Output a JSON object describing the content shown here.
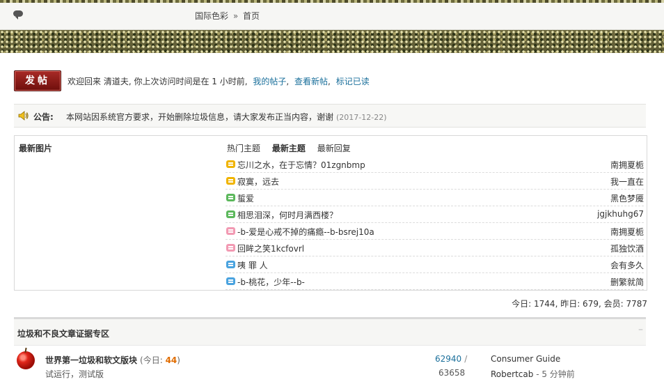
{
  "breadcrumb": {
    "site": "国际色彩",
    "separator": "»",
    "current": "首页"
  },
  "toolbar": {
    "post_button": "发帖"
  },
  "welcome": {
    "text": "欢迎回来 清道夫, 你上次访问时间是在 1 小时前,",
    "links": [
      "我的帖子",
      "查看新帖",
      "标记已读"
    ]
  },
  "notice": {
    "label": "公告:",
    "text": "本网站因系统官方要求，开始删除垃圾信息，请大家发布正当内容，谢谢",
    "date": "(2017-12-22)"
  },
  "panel": {
    "pics_title": "最新图片",
    "tabs": [
      "热门主题",
      "最新主题",
      "最新回复"
    ],
    "active_tab": "最新主题",
    "threads": [
      {
        "title": "忘川之水，在于忘情？01zgnbmp",
        "author": "南拥夏栀",
        "icon_color": "#f0b400"
      },
      {
        "title": "寂寞，远去",
        "author": "我一直在",
        "icon_color": "#f0b400"
      },
      {
        "title": "蜇爱",
        "author": "黑色梦魇",
        "icon_color": "#5cb85c"
      },
      {
        "title": "相思泪深，何时月满西楼？",
        "author": "jgjkhuhg67",
        "icon_color": "#5cb85c"
      },
      {
        "title": "-b-爱是心戒不掉的痛瘾--b-bsrej10a",
        "author": "南拥夏栀",
        "icon_color": "#f29ab3"
      },
      {
        "title": "回眸之笑1kcfovrl",
        "author": "孤独饮酒",
        "icon_color": "#f29ab3"
      },
      {
        "title": "咦 罪 人",
        "author": "会有多久",
        "icon_color": "#4aa3df"
      },
      {
        "title": "-b-桃花，少年--b-",
        "author": "删繁就简",
        "icon_color": "#4aa3df"
      }
    ]
  },
  "stats": "今日: 1744, 昨日: 679, 会员: 7787",
  "section": {
    "title": "垃圾和不良文章证据专区",
    "collapse_icon": "–"
  },
  "forum": {
    "name": "世界第一垃圾和软文版块",
    "today_label": "(今日: ",
    "today_count": "44",
    "today_close": ")",
    "description": "试运行，测试版",
    "threads": "62940",
    "slash": "/",
    "posts": "63658",
    "last_title": "Consumer Guide",
    "last_user": "Robertcab",
    "last_time": "- 5 分钟前"
  }
}
